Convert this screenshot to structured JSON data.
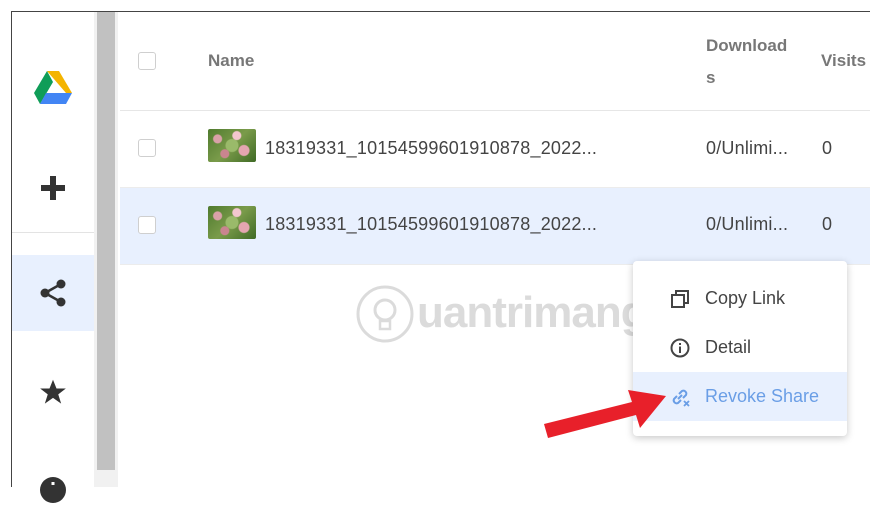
{
  "rail": {
    "items": [
      {
        "name": "google-drive-logo-icon"
      },
      {
        "name": "add-icon"
      },
      {
        "name": "share-icon"
      },
      {
        "name": "star-icon"
      },
      {
        "name": "info-icon"
      }
    ]
  },
  "table": {
    "headers": {
      "name": "Name",
      "downloads_line1": "Download",
      "downloads_line2": "s",
      "visits": "Visits"
    },
    "rows": [
      {
        "file_name": "18319331_10154599601910878_2022...",
        "downloads": "0/Unlimi...",
        "visits": "0"
      },
      {
        "file_name": "18319331_10154599601910878_2022...",
        "downloads": "0/Unlimi...",
        "visits": "0"
      }
    ]
  },
  "context_menu": {
    "items": [
      {
        "label": "Copy Link",
        "icon": "copy-icon"
      },
      {
        "label": "Detail",
        "icon": "info-icon"
      },
      {
        "label": "Revoke Share",
        "icon": "unlink-icon"
      }
    ]
  },
  "watermark": {
    "text": "uantrimang"
  },
  "colors": {
    "selected_row": "#e8f0fe",
    "accent": "#6a9ee6",
    "arrow": "#e8202a"
  }
}
